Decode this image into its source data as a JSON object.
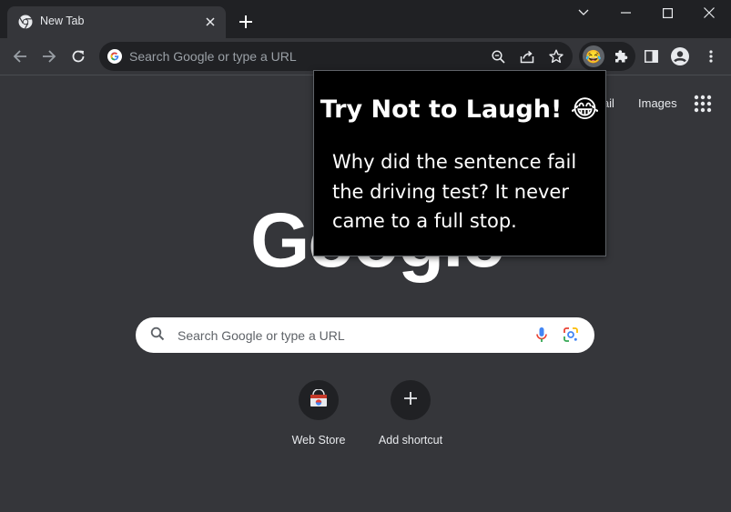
{
  "browser": {
    "tab": {
      "title": "New Tab"
    },
    "omnibox": {
      "placeholder": "Search Google or type a URL"
    }
  },
  "extension": {
    "badge": "😂",
    "popup": {
      "title": "Try Not to Laugh!",
      "title_emoji": "😂",
      "joke": "Why did the sentence fail the driving test? It never came to a full stop."
    }
  },
  "newtab": {
    "links": {
      "gmail": "Gmail",
      "images": "Images"
    },
    "logo": "Google",
    "search_placeholder": "Search Google or type a URL",
    "shortcuts": [
      {
        "label": "Web Store",
        "icon": "webstore-icon"
      },
      {
        "label": "Add shortcut",
        "icon": "plus-icon"
      }
    ]
  },
  "colors": {
    "frame": "#202124",
    "toolbar": "#35363a",
    "popup_bg": "#000000",
    "text": "#e8eaed"
  }
}
